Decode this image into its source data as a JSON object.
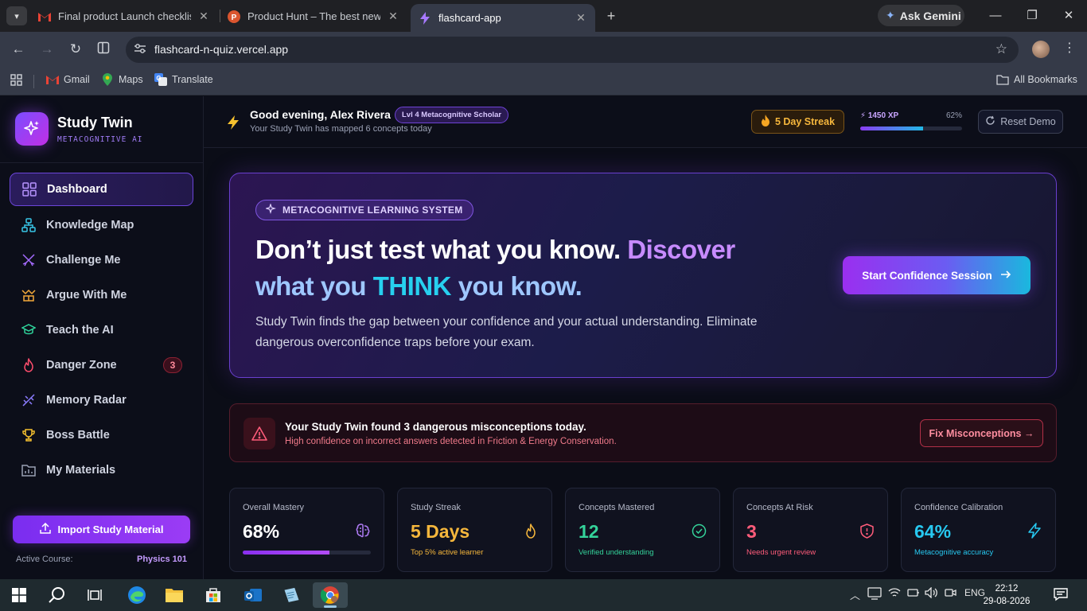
{
  "browser": {
    "tabs": [
      {
        "title": "Final product Launch checklist - ",
        "icon": "gmail-icon"
      },
      {
        "title": "Product Hunt – The best new p",
        "icon": "producthunt-icon"
      },
      {
        "title": "flashcard-app",
        "icon": "app-bolt-icon"
      }
    ],
    "active_tab": 2,
    "ask_gemini": "Ask Gemini",
    "url": "flashcard-n-quiz.vercel.app",
    "bookmarks": {
      "gmail": "Gmail",
      "maps": "Maps",
      "translate": "Translate",
      "all": "All Bookmarks"
    }
  },
  "sidebar": {
    "brand_name": "Study Twin",
    "brand_sub": "METACOGNITIVE AI",
    "items": [
      {
        "label": "Dashboard",
        "icon": "grid-icon",
        "active": true
      },
      {
        "label": "Knowledge Map",
        "icon": "network-icon"
      },
      {
        "label": "Challenge Me",
        "icon": "swords-icon"
      },
      {
        "label": "Argue With Me",
        "icon": "debate-icon"
      },
      {
        "label": "Teach the AI",
        "icon": "graduation-cap-icon"
      },
      {
        "label": "Danger Zone",
        "icon": "flame-icon",
        "badge": "3"
      },
      {
        "label": "Memory Radar",
        "icon": "dna-icon"
      },
      {
        "label": "Boss Battle",
        "icon": "trophy-icon"
      },
      {
        "label": "My Materials",
        "icon": "folder-icon"
      }
    ],
    "import_label": "Import Study Material",
    "active_course_label": "Active Course:",
    "active_course_value": "Physics 101"
  },
  "header": {
    "greeting": "Good evening, Alex Rivera",
    "level_badge": "Lvl 4 Metacognitive Scholar",
    "subtitle": "Your Study Twin has mapped 6 concepts today",
    "streak": "5 Day Streak",
    "xp_label": "1450 XP",
    "xp_percent_label": "62%",
    "xp_progress": 0.62,
    "reset_label": "Reset Demo"
  },
  "hero": {
    "chip": "METACOGNITIVE LEARNING SYSTEM",
    "title_part1": "Don’t just test what you know.",
    "title_discover": "Discover",
    "title_what_you": "what you",
    "title_think": "THINK",
    "title_you_know": "you know.",
    "description": "Study Twin finds the gap between your confidence and your actual understanding. Eliminate dangerous overconfidence traps before your exam.",
    "cta": "Start Confidence Session"
  },
  "alert": {
    "title": "Your Study Twin found 3 dangerous misconceptions today.",
    "subtitle": "High confidence on incorrect answers detected in Friction & Energy Conservation.",
    "button": "Fix Misconceptions →"
  },
  "stats": [
    {
      "label": "Overall Mastery",
      "value": "68%",
      "progress": 0.68,
      "icon": "brain-icon",
      "color": "#ffffff",
      "icon_color": "#b07cf7"
    },
    {
      "label": "Study Streak",
      "value": "5 Days",
      "sub": "Top 5% active learner",
      "icon": "flame-icon",
      "color": "#f6b73c",
      "sub_color": "#f6b73c",
      "icon_color": "#f6b73c"
    },
    {
      "label": "Concepts Mastered",
      "value": "12",
      "sub": "Verified understanding",
      "icon": "check-circle-icon",
      "color": "#34d39a",
      "sub_color": "#34d39a",
      "icon_color": "#34d39a"
    },
    {
      "label": "Concepts At Risk",
      "value": "3",
      "sub": "Needs urgent review",
      "icon": "shield-alert-icon",
      "color": "#ff5c7a",
      "sub_color": "#ff5c7a",
      "icon_color": "#ff5c7a"
    },
    {
      "label": "Confidence Calibration",
      "value": "64%",
      "sub": "Metacognitive accuracy",
      "icon": "bolt-icon",
      "color": "#27c8f0",
      "sub_color": "#27c8f0",
      "icon_color": "#27c8f0"
    }
  ],
  "taskbar": {
    "lang": "ENG",
    "time": "22:12",
    "date": "29-08-2026"
  }
}
